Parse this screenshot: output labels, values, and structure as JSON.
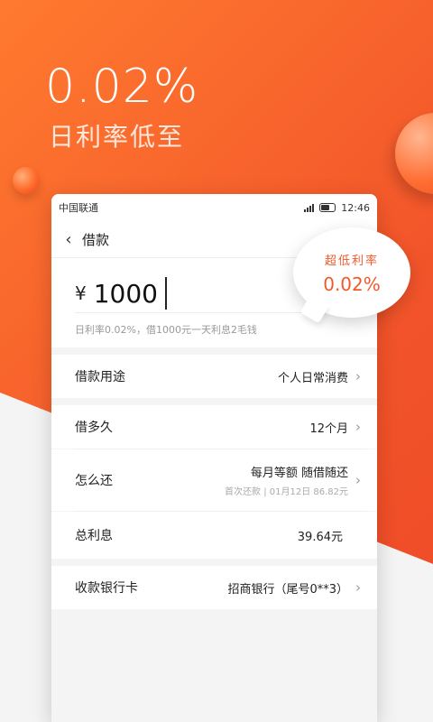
{
  "promo": {
    "rate": "0.02%",
    "subtitle": "日利率低至"
  },
  "status": {
    "carrier": "中国联通",
    "time": "12:46"
  },
  "nav": {
    "title": "借款"
  },
  "loan": {
    "currency": "¥",
    "amount": "1000",
    "hint": "日利率0.02%，借1000元一天利息2毛钱"
  },
  "rows": {
    "purpose": {
      "label": "借款用途",
      "value": "个人日常消费"
    },
    "term": {
      "label": "借多久",
      "value": "12个月"
    },
    "repay": {
      "label": "怎么还",
      "method": "每月等额  随借随还",
      "detail": "首次还款 | 01月12日 86.82元"
    },
    "interest": {
      "label": "总利息",
      "value": "39.64元"
    },
    "card": {
      "label": "收款银行卡",
      "value": "招商银行（尾号0**3）"
    }
  },
  "bubble": {
    "title": "超低利率",
    "rate": "0.02%"
  },
  "colors": {
    "brand_orange": "#F2542A",
    "bubble_text": "#F05A2A"
  }
}
